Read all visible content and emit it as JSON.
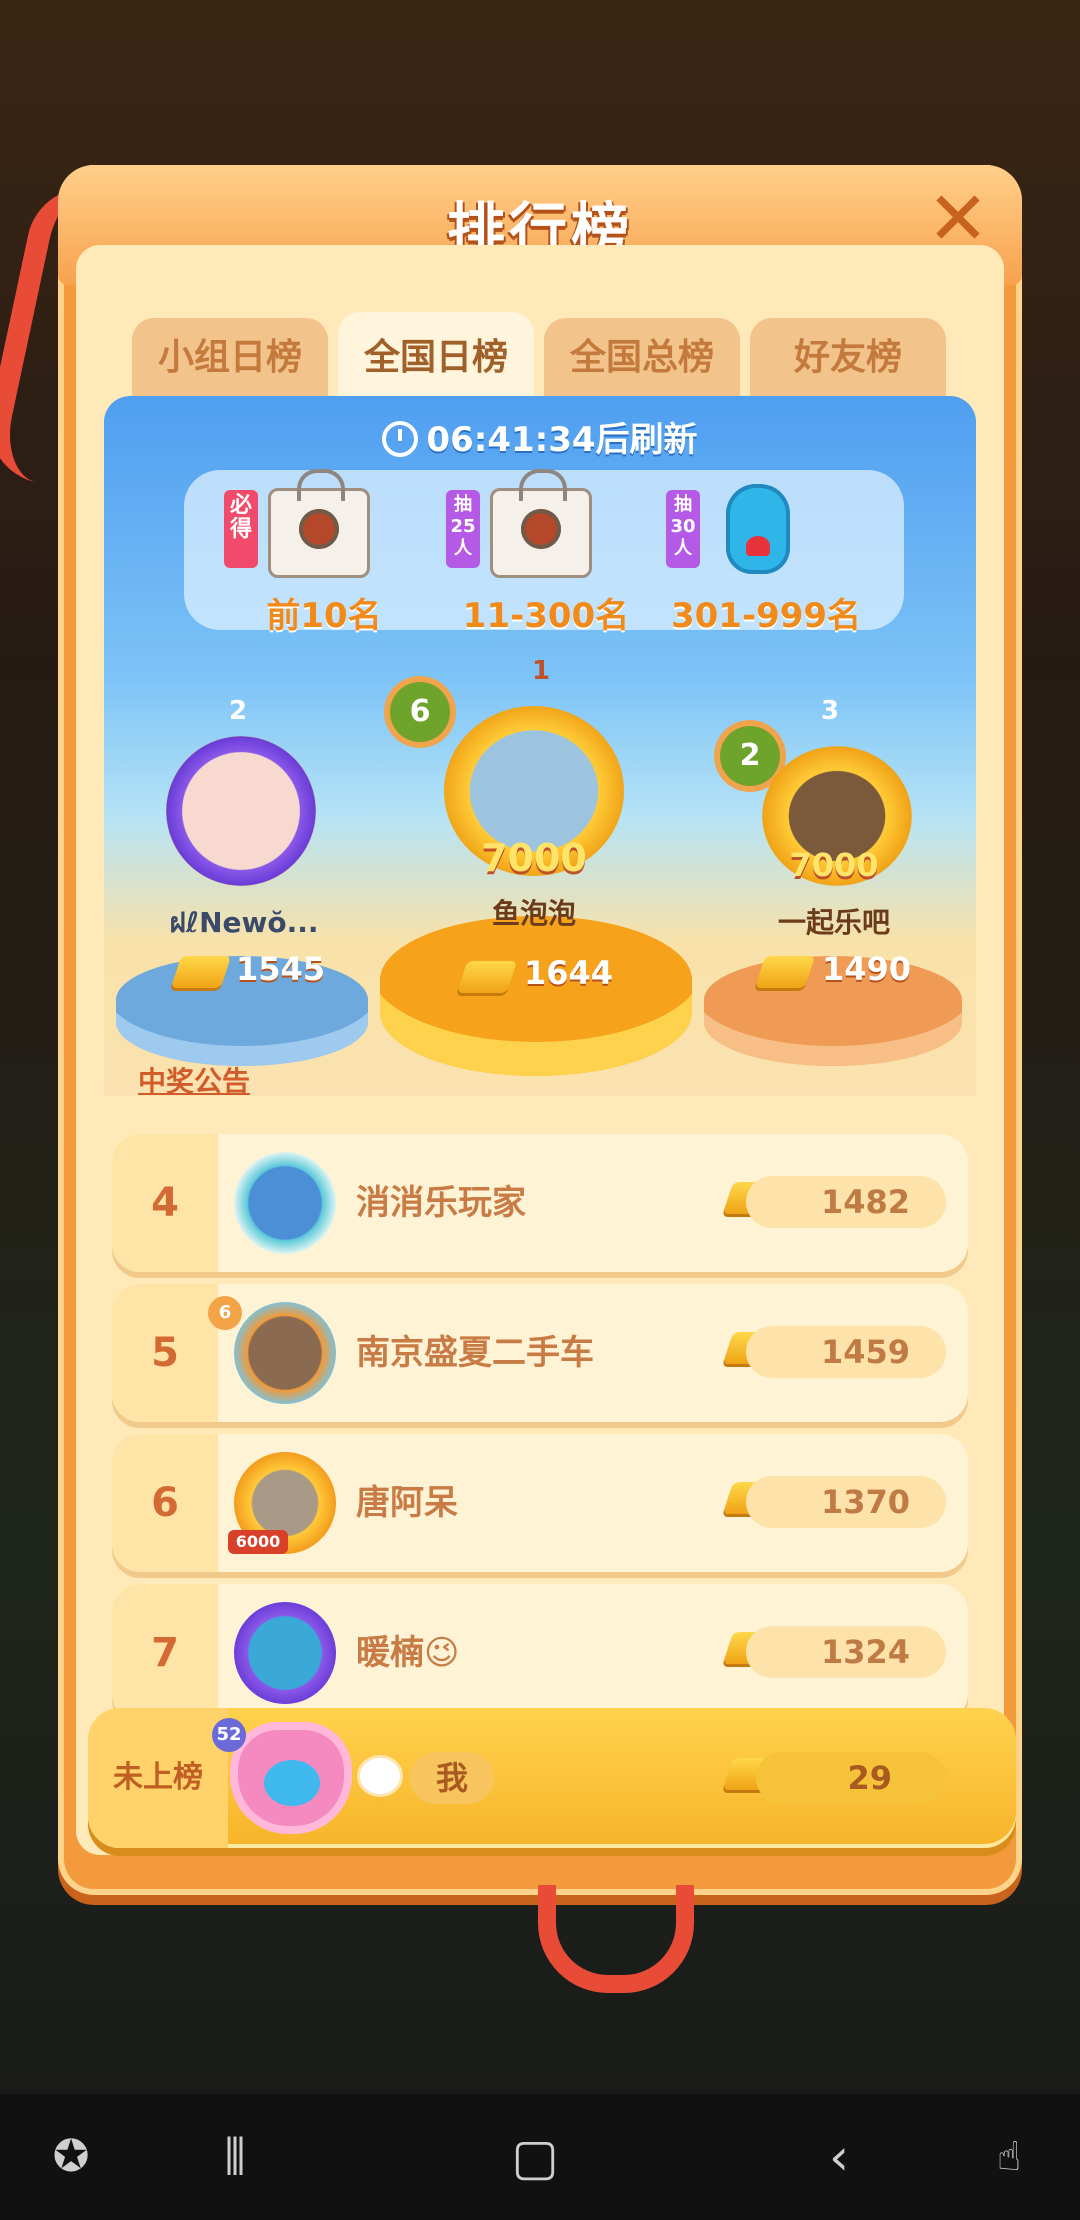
{
  "header": {
    "title": "排行榜"
  },
  "tabs": [
    {
      "label": "小组日榜",
      "active": false
    },
    {
      "label": "全国日榜",
      "active": true
    },
    {
      "label": "全国总榜",
      "active": false
    },
    {
      "label": "好友榜",
      "active": false
    }
  ],
  "timer": {
    "text": "06:41:34后刷新"
  },
  "prizes": [
    {
      "tag": "必得",
      "label": "前10名",
      "icon": "gift-bag-icon",
      "tag_color": "#f24a6a"
    },
    {
      "tag": "抽25人",
      "label": "11-300名",
      "icon": "gift-bag-icon",
      "tag_color": "#b55ae6"
    },
    {
      "tag": "抽30人",
      "label": "301-999名",
      "icon": "hippo-plush-icon",
      "tag_color": "#b55ae6"
    }
  ],
  "podium": [
    {
      "place": "2",
      "name": "ฝℓNewŏ...",
      "score": "1545",
      "crown_color": "#9bd0ff"
    },
    {
      "place": "1",
      "name": "鱼泡泡",
      "score": "1644",
      "badge": "6",
      "banner": "7000",
      "crown_color": "#ffc43d"
    },
    {
      "place": "3",
      "name": "一起乐吧",
      "score": "1490",
      "badge": "2",
      "banner": "7000",
      "crown_color": "#f3a449"
    }
  ],
  "announcement": "中奖公告",
  "rows": [
    {
      "rank": "4",
      "name": "消消乐玩家",
      "score": "1482"
    },
    {
      "rank": "5",
      "name": "南京盛夏二手车",
      "score": "1459",
      "level": "6"
    },
    {
      "rank": "6",
      "name": "唐阿呆",
      "score": "1370",
      "badge": "6000"
    },
    {
      "rank": "7",
      "name": "暖楠😉",
      "score": "1324"
    }
  ],
  "me": {
    "rank_text": "未上榜",
    "level": "52",
    "name": "我",
    "score": "29"
  },
  "navbar": [
    "game-launcher-icon",
    "recent-apps-icon",
    "home-icon",
    "back-icon",
    "touch-lock-icon"
  ]
}
